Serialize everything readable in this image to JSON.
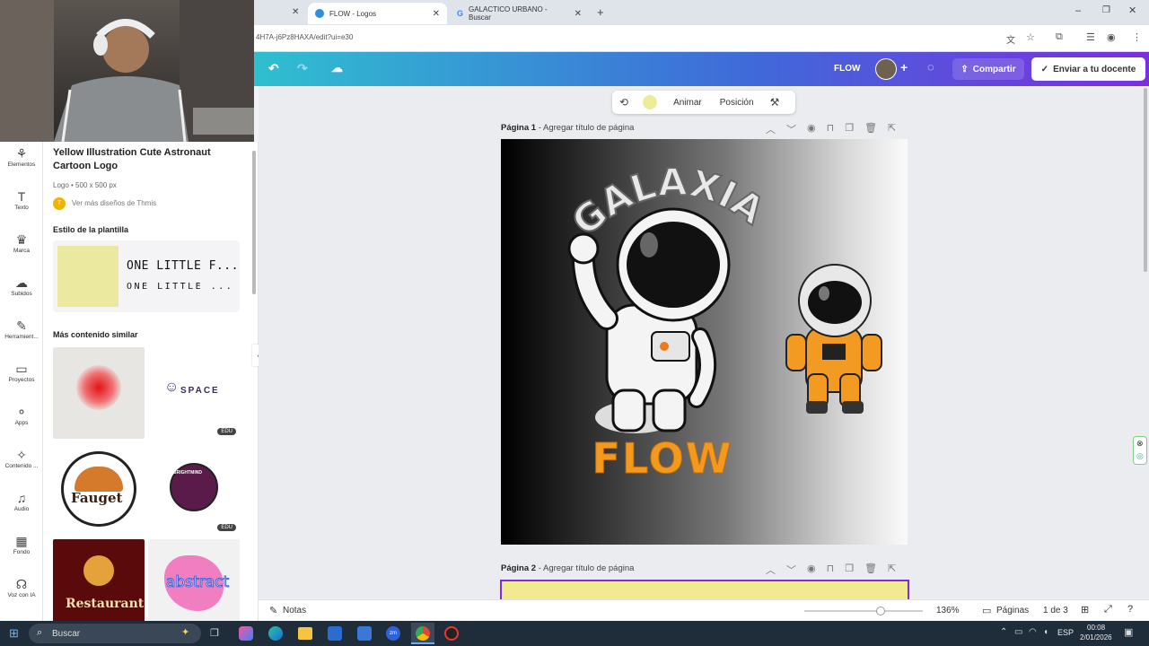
{
  "browser": {
    "tabs": [
      {
        "label": "FLOW - Logos",
        "active": true
      },
      {
        "label": "GALACTICO URBANO - Buscar",
        "active": false
      }
    ],
    "url": "4H7A-j6Pz8HAXA/edit?ui=e30"
  },
  "canva_header": {
    "design_name": "FLOW",
    "share_label": "Compartir",
    "send_label": "Enviar a tu docente"
  },
  "rail": [
    {
      "label": "Elementos",
      "icon": "elements-icon",
      "glyph": "⚘"
    },
    {
      "label": "Texto",
      "icon": "text-icon",
      "glyph": "T"
    },
    {
      "label": "Marca",
      "icon": "brand-icon",
      "glyph": "♛"
    },
    {
      "label": "Subidos",
      "icon": "upload-icon",
      "glyph": "☁"
    },
    {
      "label": "Herramient...",
      "icon": "tools-icon",
      "glyph": "✎"
    },
    {
      "label": "Proyectos",
      "icon": "folder-icon",
      "glyph": "▭"
    },
    {
      "label": "Apps",
      "icon": "apps-icon",
      "glyph": "⚬"
    },
    {
      "label": "Contenido ...",
      "icon": "content-icon",
      "glyph": "✧"
    },
    {
      "label": "Audio",
      "icon": "audio-icon",
      "glyph": "♫"
    },
    {
      "label": "Fondo",
      "icon": "background-icon",
      "glyph": "▦"
    },
    {
      "label": "Voz con IA",
      "icon": "ai-voice-icon",
      "glyph": "☊"
    }
  ],
  "panel": {
    "title": "Yellow Illustration Cute Astronaut Cartoon Logo",
    "meta": "Logo • 500 x 500 px",
    "author": "Ver más diseños de Thmis",
    "author_initial": "T",
    "style_heading": "Estilo de la plantilla",
    "style_text_1": "ONE LITTLE F...",
    "style_text_2": "ONE LITTLE ...",
    "similar_heading": "Más contenido similar",
    "thumbs": [
      {
        "text": "",
        "badge": ""
      },
      {
        "text": "SPACE",
        "badge": "EDU"
      },
      {
        "text": "Fauget",
        "badge": ""
      },
      {
        "text": "BRIGHTMIND",
        "badge": "EDU"
      },
      {
        "text": "Restaurant",
        "badge": ""
      },
      {
        "text": "abstract",
        "badge": ""
      }
    ]
  },
  "toolbar": {
    "animate": "Animar",
    "position": "Posición"
  },
  "pages": [
    {
      "label": "Página 1",
      "title_hint": "- Agregar título de página"
    },
    {
      "label": "Página 2",
      "title_hint": "- Agregar título de página"
    }
  ],
  "design": {
    "arc_text": "GALAXIA",
    "main_text": "FLOW"
  },
  "bottom": {
    "notes": "Notas",
    "zoom": "136%",
    "pages_label": "Páginas",
    "page_count": "1 de 3"
  },
  "taskbar": {
    "search": "Buscar",
    "lang": "ESP",
    "time": "00:08",
    "date": "2/01/2026"
  },
  "colors": {
    "accent_purple": "#7d2ee0",
    "accent_teal": "#2fbfd0",
    "flow_orange": "#f39a1e",
    "page2_yellow": "#f0eb91"
  }
}
